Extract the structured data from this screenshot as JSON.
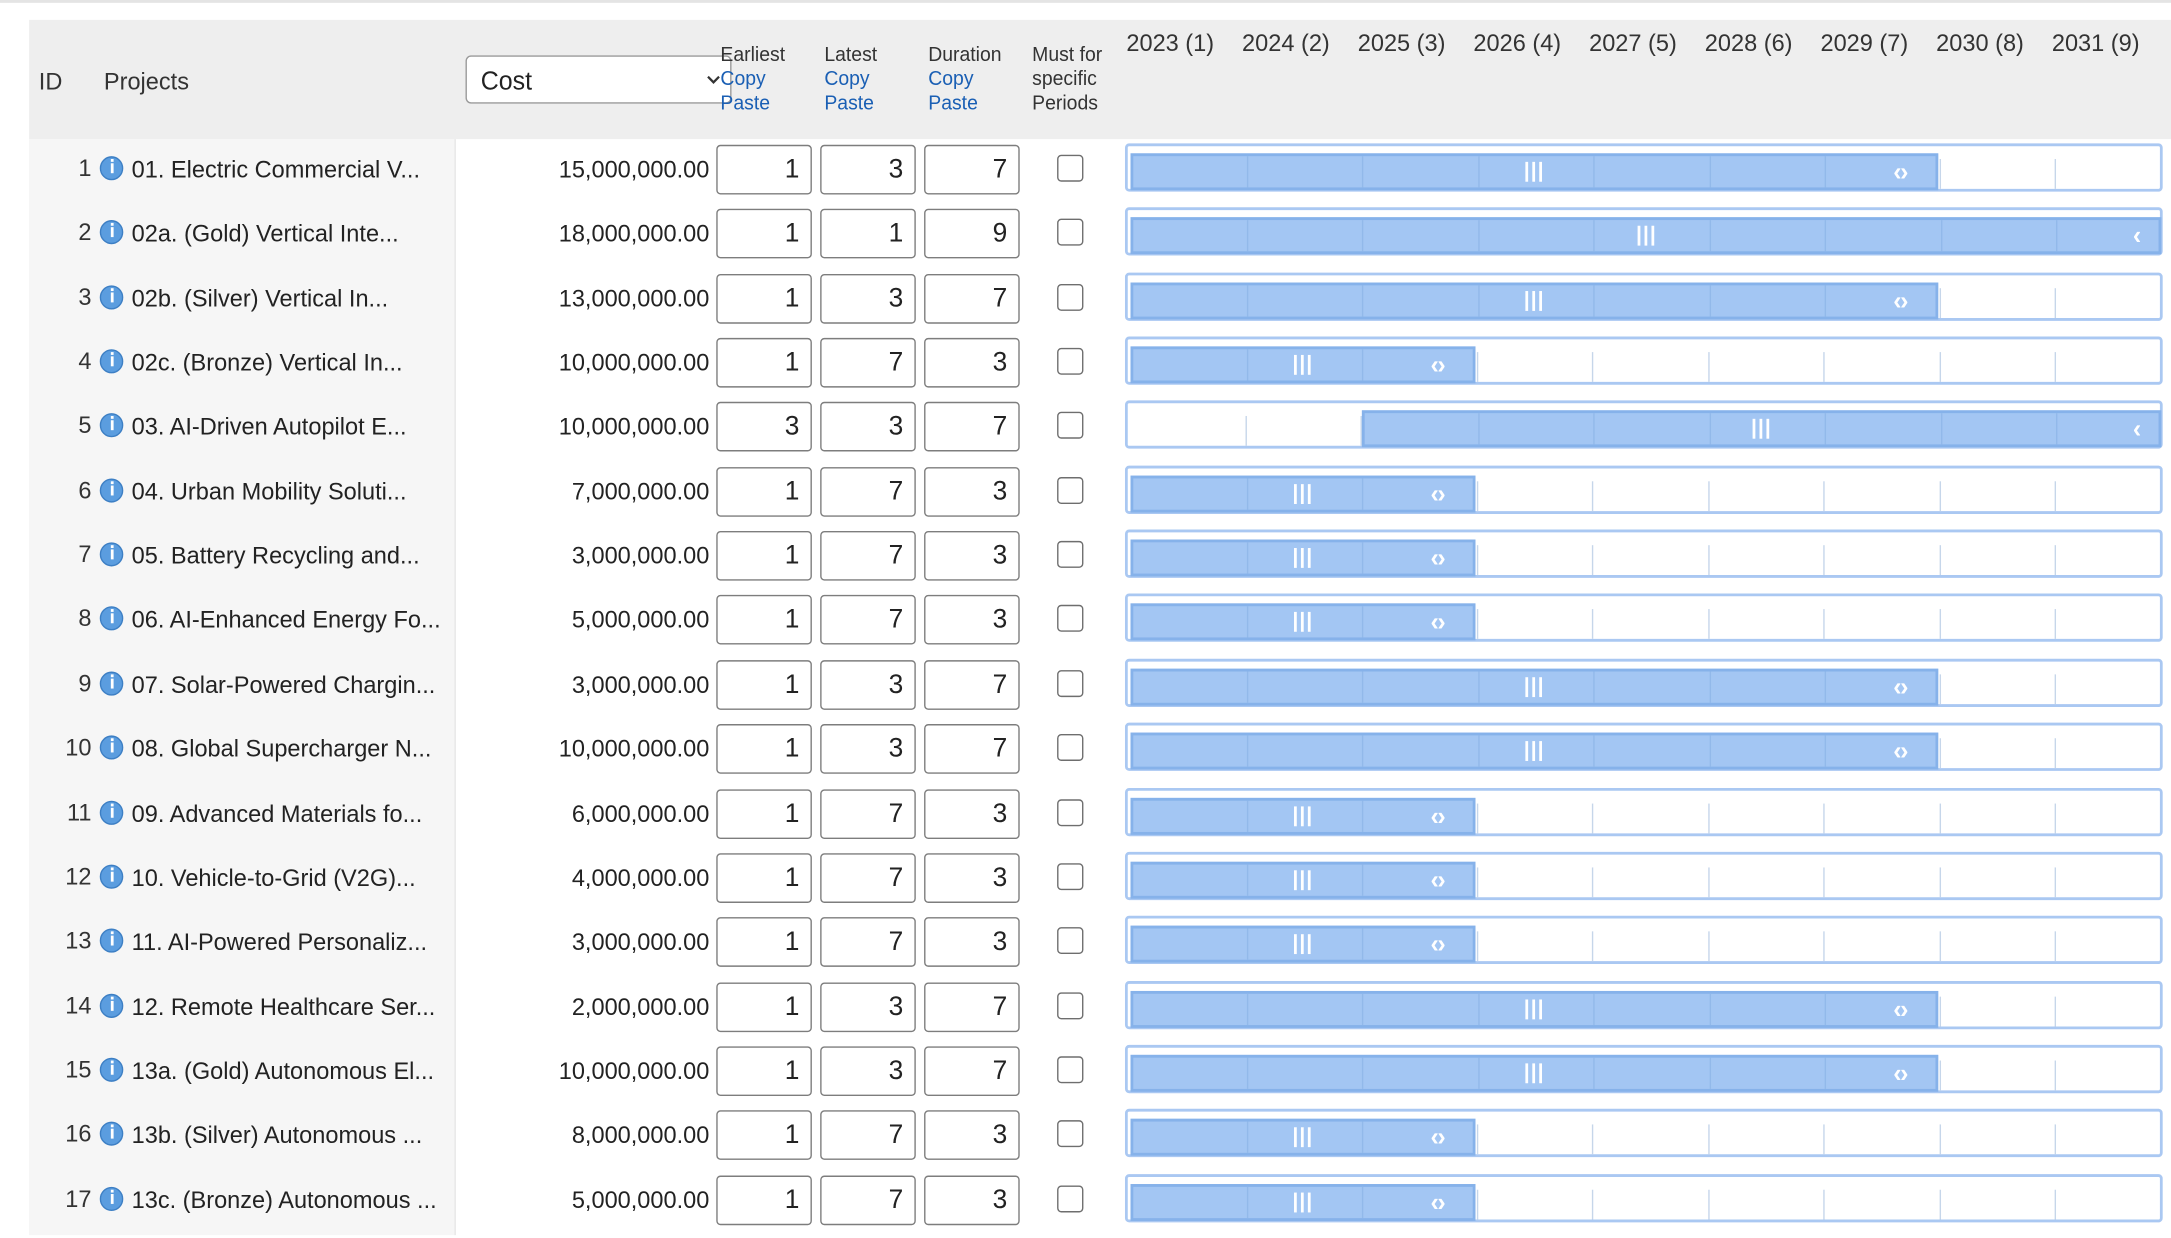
{
  "header": {
    "id_label": "ID",
    "projects_label": "Projects",
    "cost_select_value": "Cost",
    "earliest": {
      "title": "Earliest",
      "copy": "Copy",
      "paste": "Paste"
    },
    "latest": {
      "title": "Latest",
      "copy": "Copy",
      "paste": "Paste"
    },
    "duration": {
      "title": "Duration",
      "copy": "Copy",
      "paste": "Paste"
    },
    "must": {
      "line1": "Must for",
      "line2": "specific",
      "line3": "Periods"
    },
    "years": [
      "2023 (1)",
      "2024 (2)",
      "2025 (3)",
      "2026 (4)",
      "2027 (5)",
      "2028 (6)",
      "2029 (7)",
      "2030 (8)",
      "2031 (9)"
    ]
  },
  "colors": {
    "bar_fill": "#a3c6f3",
    "bar_border": "#86b2ea",
    "link": "#1a5fb4",
    "header_bg": "#eeeeee",
    "info_icon": "#5b9ddf"
  },
  "rows": [
    {
      "id": "1",
      "name": "01. Electric Commercial V...",
      "cost": "15,000,000.00",
      "earliest": "1",
      "latest": "3",
      "duration": "7",
      "must": false
    },
    {
      "id": "2",
      "name": "02a. (Gold) Vertical Inte...",
      "cost": "18,000,000.00",
      "earliest": "1",
      "latest": "1",
      "duration": "9",
      "must": false
    },
    {
      "id": "3",
      "name": "02b. (Silver) Vertical In...",
      "cost": "13,000,000.00",
      "earliest": "1",
      "latest": "3",
      "duration": "7",
      "must": false
    },
    {
      "id": "4",
      "name": "02c. (Bronze) Vertical In...",
      "cost": "10,000,000.00",
      "earliest": "1",
      "latest": "7",
      "duration": "3",
      "must": false
    },
    {
      "id": "5",
      "name": "03. AI-Driven Autopilot E...",
      "cost": "10,000,000.00",
      "earliest": "3",
      "latest": "3",
      "duration": "7",
      "must": false
    },
    {
      "id": "6",
      "name": "04. Urban Mobility Soluti...",
      "cost": "7,000,000.00",
      "earliest": "1",
      "latest": "7",
      "duration": "3",
      "must": false
    },
    {
      "id": "7",
      "name": "05. Battery Recycling and...",
      "cost": "3,000,000.00",
      "earliest": "1",
      "latest": "7",
      "duration": "3",
      "must": false
    },
    {
      "id": "8",
      "name": "06. AI-Enhanced Energy Fo...",
      "cost": "5,000,000.00",
      "earliest": "1",
      "latest": "7",
      "duration": "3",
      "must": false
    },
    {
      "id": "9",
      "name": "07. Solar-Powered Chargin...",
      "cost": "3,000,000.00",
      "earliest": "1",
      "latest": "3",
      "duration": "7",
      "must": false
    },
    {
      "id": "10",
      "name": "08. Global Supercharger N...",
      "cost": "10,000,000.00",
      "earliest": "1",
      "latest": "3",
      "duration": "7",
      "must": false
    },
    {
      "id": "11",
      "name": "09. Advanced Materials fo...",
      "cost": "6,000,000.00",
      "earliest": "1",
      "latest": "7",
      "duration": "3",
      "must": false
    },
    {
      "id": "12",
      "name": "10. Vehicle-to-Grid (V2G)...",
      "cost": "4,000,000.00",
      "earliest": "1",
      "latest": "7",
      "duration": "3",
      "must": false
    },
    {
      "id": "13",
      "name": "11. AI-Powered Personaliz...",
      "cost": "3,000,000.00",
      "earliest": "1",
      "latest": "7",
      "duration": "3",
      "must": false
    },
    {
      "id": "14",
      "name": "12. Remote Healthcare Ser...",
      "cost": "2,000,000.00",
      "earliest": "1",
      "latest": "3",
      "duration": "7",
      "must": false
    },
    {
      "id": "15",
      "name": "13a. (Gold) Autonomous El...",
      "cost": "10,000,000.00",
      "earliest": "1",
      "latest": "3",
      "duration": "7",
      "must": false
    },
    {
      "id": "16",
      "name": "13b. (Silver) Autonomous ...",
      "cost": "8,000,000.00",
      "earliest": "1",
      "latest": "7",
      "duration": "3",
      "must": false
    },
    {
      "id": "17",
      "name": "13c. (Bronze) Autonomous ...",
      "cost": "5,000,000.00",
      "earliest": "1",
      "latest": "7",
      "duration": "3",
      "must": false
    }
  ]
}
